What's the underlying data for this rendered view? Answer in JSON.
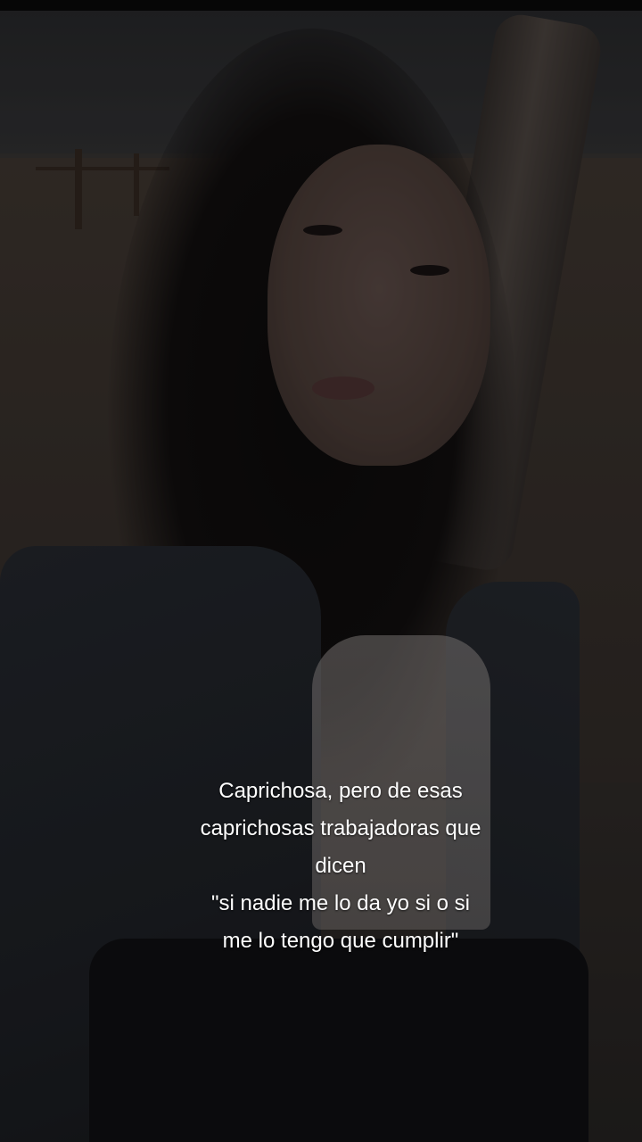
{
  "post": {
    "caption_lines": [
      "Caprichosa, pero de esas",
      "caprichosas trabajadoras que",
      "dicen",
      "\"si nadie me lo da yo si o si",
      "me lo tengo que cumplir\""
    ]
  },
  "background": {
    "image_subject": "selfie-photo"
  }
}
